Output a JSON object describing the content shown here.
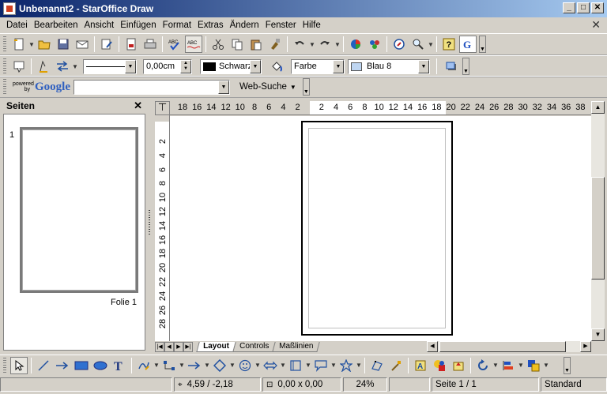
{
  "window": {
    "title": "Unbenannt2 - StarOffice Draw",
    "minimize": "_",
    "maximize": "□",
    "close": "✕"
  },
  "menu": {
    "items": [
      "Datei",
      "Bearbeiten",
      "Ansicht",
      "Einfügen",
      "Format",
      "Extras",
      "Ändern",
      "Fenster",
      "Hilfe"
    ],
    "doc_close": "✕"
  },
  "line_toolbar": {
    "line_width": "0,00cm",
    "line_color": "Schwarz",
    "area_style": "Farbe",
    "area_color": "Blau 8",
    "colors": {
      "line": "#000000",
      "area": "#bfd6f2"
    }
  },
  "google_toolbar": {
    "powered_by": "powered by",
    "brand": "Google",
    "search_value": "",
    "search_button": "Web-Suche"
  },
  "pages_panel": {
    "title": "Seiten",
    "close": "✕",
    "slides": [
      {
        "number": "1",
        "name": "Folie 1"
      }
    ]
  },
  "ruler": {
    "corner": "⊤",
    "horizontal_ticks": [
      "18",
      "16",
      "14",
      "12",
      "10",
      "8",
      "6",
      "4",
      "2",
      "2",
      "4",
      "6",
      "8",
      "10",
      "12",
      "14",
      "16",
      "18",
      "20",
      "22",
      "24",
      "26",
      "28",
      "30",
      "32",
      "34",
      "36",
      "38"
    ],
    "vertical_ticks": [
      "2",
      "4",
      "6",
      "8",
      "10",
      "12",
      "14",
      "16",
      "18",
      "20",
      "22",
      "24",
      "26",
      "28"
    ]
  },
  "tabs": [
    {
      "label": "Layout",
      "active": true
    },
    {
      "label": "Controls",
      "active": false
    },
    {
      "label": "Maßlinien",
      "active": false
    }
  ],
  "statusbar": {
    "position": "4,59 / -2,18",
    "size": "0,00 x 0,00",
    "zoom": "24%",
    "page": "Seite 1 / 1",
    "layout": "Standard"
  }
}
